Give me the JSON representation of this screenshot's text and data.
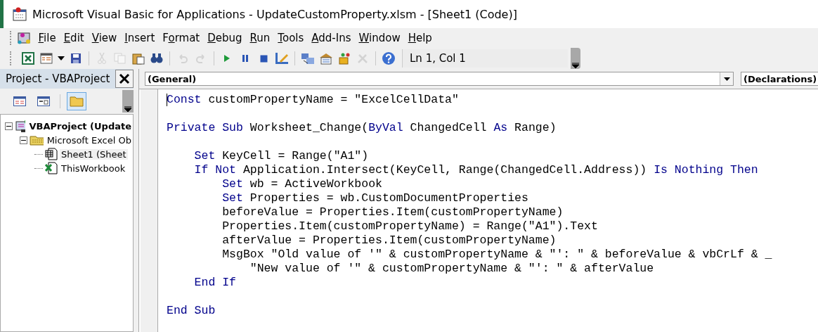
{
  "window": {
    "title": "Microsoft Visual Basic for Applications - UpdateCustomProperty.xlsm - [Sheet1 (Code)]"
  },
  "menu": [
    {
      "key": "F",
      "post": "ile"
    },
    {
      "key": "E",
      "post": "dit"
    },
    {
      "key": "V",
      "post": "iew"
    },
    {
      "key": "I",
      "post": "nsert"
    },
    {
      "pre": "F",
      "key": "o",
      "post": "rmat"
    },
    {
      "key": "D",
      "post": "ebug"
    },
    {
      "key": "R",
      "post": "un"
    },
    {
      "key": "T",
      "post": "ools"
    },
    {
      "key": "A",
      "post": "dd-Ins"
    },
    {
      "key": "W",
      "post": "indow"
    },
    {
      "key": "H",
      "post": "elp"
    }
  ],
  "toolbar": [
    [
      {
        "kind": "excel",
        "disabled": false
      },
      {
        "kind": "insert",
        "disabled": false
      },
      {
        "kind": "caret",
        "disabled": false
      },
      {
        "kind": "save",
        "disabled": false
      }
    ],
    [
      {
        "kind": "cut",
        "disabled": true
      },
      {
        "kind": "copy",
        "disabled": true
      },
      {
        "kind": "paste",
        "disabled": false
      },
      {
        "kind": "find",
        "disabled": false
      }
    ],
    [
      {
        "kind": "undo",
        "disabled": true
      },
      {
        "kind": "redo",
        "disabled": true
      }
    ],
    [
      {
        "kind": "run",
        "disabled": false
      },
      {
        "kind": "pause",
        "disabled": false
      },
      {
        "kind": "stop",
        "disabled": false
      },
      {
        "kind": "design",
        "disabled": false
      }
    ],
    [
      {
        "kind": "explorer",
        "disabled": false
      },
      {
        "kind": "properties",
        "disabled": false
      },
      {
        "kind": "objects",
        "disabled": false
      },
      {
        "kind": "tools",
        "disabled": true
      }
    ],
    [
      {
        "kind": "help",
        "disabled": false
      }
    ]
  ],
  "position": "Ln 1, Col 1",
  "project": {
    "title": "Project - VBAProject",
    "view_buttons": [
      {
        "kind": "code",
        "selected": false
      },
      {
        "kind": "object",
        "selected": false
      },
      {
        "kind": "folders",
        "selected": true
      }
    ],
    "tree": [
      {
        "label": "VBAProject (Update",
        "kind": "project",
        "bold": true,
        "selected": false,
        "expanded": true,
        "children": [
          {
            "label": "Microsoft Excel Ob",
            "kind": "folder",
            "bold": false,
            "selected": false,
            "expanded": true,
            "children": [
              {
                "label": "Sheet1 (Sheet",
                "kind": "sheet",
                "bold": false,
                "selected": true
              },
              {
                "label": "ThisWorkbook",
                "kind": "workbook",
                "bold": false,
                "selected": false
              }
            ]
          }
        ]
      }
    ]
  },
  "code": {
    "object": "(General)",
    "procedure": "(Declarations)",
    "lines": [
      {
        "gap_before": false,
        "tokens": [
          {
            "text": "Const",
            "kind": "keyword"
          },
          {
            "text": " customPropertyName = \"ExcelCellData\"",
            "kind": "plain"
          }
        ]
      },
      {
        "gap_before": true,
        "tokens": [
          {
            "text": "Private Sub",
            "kind": "keyword"
          },
          {
            "text": " Worksheet_Change(",
            "kind": "plain"
          },
          {
            "text": "ByVal",
            "kind": "keyword"
          },
          {
            "text": " ChangedCell ",
            "kind": "plain"
          },
          {
            "text": "As",
            "kind": "keyword"
          },
          {
            "text": " Range)",
            "kind": "plain"
          }
        ],
        "children": [
          {
            "gap_before": true,
            "tokens": [
              {
                "text": "Set",
                "kind": "keyword"
              },
              {
                "text": " KeyCell = Range(\"A1\")",
                "kind": "plain"
              }
            ]
          },
          {
            "gap_before": false,
            "tokens": [
              {
                "text": "If Not",
                "kind": "keyword"
              },
              {
                "text": " Application.Intersect(KeyCell, Range(ChangedCell.Address)) ",
                "kind": "plain"
              },
              {
                "text": "Is Nothing Then",
                "kind": "keyword"
              }
            ],
            "children": [
              {
                "gap_before": false,
                "tokens": [
                  {
                    "text": "Set",
                    "kind": "keyword"
                  },
                  {
                    "text": " wb = ActiveWorkbook",
                    "kind": "plain"
                  }
                ]
              },
              {
                "gap_before": false,
                "tokens": [
                  {
                    "text": "Set",
                    "kind": "keyword"
                  },
                  {
                    "text": " Properties = wb.CustomDocumentProperties",
                    "kind": "plain"
                  }
                ]
              },
              {
                "gap_before": false,
                "tokens": [
                  {
                    "text": "beforeValue = Properties.Item(customPropertyName)",
                    "kind": "plain"
                  }
                ]
              },
              {
                "gap_before": false,
                "tokens": [
                  {
                    "text": "Properties.Item(customPropertyName) = Range(\"A1\").Text",
                    "kind": "plain"
                  }
                ]
              },
              {
                "gap_before": false,
                "tokens": [
                  {
                    "text": "afterValue = Properties.Item(customPropertyName)",
                    "kind": "plain"
                  }
                ]
              },
              {
                "gap_before": false,
                "tokens": [
                  {
                    "text": "MsgBox \"Old value of '\" & customPropertyName & \"': \" & beforeValue & vbCrLf & _",
                    "kind": "plain"
                  }
                ],
                "children": [
                  {
                    "gap_before": false,
                    "tokens": [
                      {
                        "text": "\"New value of '\" & customPropertyName & \"': \" & afterValue",
                        "kind": "plain"
                      }
                    ]
                  }
                ]
              }
            ]
          },
          {
            "gap_before": false,
            "tokens": [
              {
                "text": "End If",
                "kind": "keyword"
              }
            ]
          }
        ]
      },
      {
        "gap_before": true,
        "tokens": [
          {
            "text": "End Sub",
            "kind": "keyword"
          }
        ]
      }
    ]
  }
}
